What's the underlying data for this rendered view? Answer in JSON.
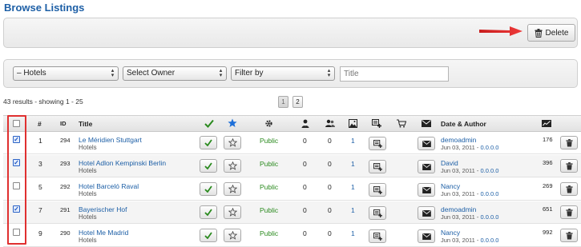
{
  "page": {
    "title": "Browse Listings"
  },
  "toolbar": {
    "delete_label": "Delete"
  },
  "filters": {
    "category": "– Hotels",
    "owner": "Select Owner",
    "filter_by": "Filter by",
    "title_placeholder": "Title"
  },
  "results": {
    "info": "43 results - showing 1 - 25"
  },
  "pagination": [
    "1",
    "2"
  ],
  "columns": {
    "num": "#",
    "id": "ID",
    "title": "Title",
    "date_author": "Date & Author"
  },
  "rows": [
    {
      "checked": true,
      "num": "1",
      "id": "294",
      "title": "Le Méridien Stuttgart",
      "category": "Hotels",
      "status": "Public",
      "c1": "0",
      "c2": "0",
      "images": "1",
      "author": "demoadmin",
      "date": "Jun 03, 2011 -",
      "ip": "0.0.0.0",
      "hits": "176"
    },
    {
      "checked": true,
      "num": "3",
      "id": "293",
      "title": "Hotel Adlon Kempinski Berlin",
      "category": "Hotels",
      "status": "Public",
      "c1": "0",
      "c2": "0",
      "images": "1",
      "author": "David",
      "date": "Jun 03, 2011 -",
      "ip": "0.0.0.0",
      "hits": "396"
    },
    {
      "checked": false,
      "num": "5",
      "id": "292",
      "title": "Hotel Barceló Raval",
      "category": "Hotels",
      "status": "Public",
      "c1": "0",
      "c2": "0",
      "images": "1",
      "author": "Nancy",
      "date": "Jun 03, 2011 -",
      "ip": "0.0.0.0",
      "hits": "269"
    },
    {
      "checked": true,
      "num": "7",
      "id": "291",
      "title": "Bayerischer Hof",
      "category": "Hotels",
      "status": "Public",
      "c1": "0",
      "c2": "0",
      "images": "1",
      "author": "demoadmin",
      "date": "Jun 03, 2011 -",
      "ip": "0.0.0.0",
      "hits": "651"
    },
    {
      "checked": false,
      "num": "9",
      "id": "290",
      "title": "Hotel Me Madrid",
      "category": "Hotels",
      "status": "Public",
      "c1": "0",
      "c2": "0",
      "images": "1",
      "author": "Nancy",
      "date": "Jun 03, 2011 -",
      "ip": "0.0.0.0",
      "hits": "992"
    }
  ],
  "colors": {
    "accent": "#1d5fa6",
    "public": "#2a8a1e",
    "highlight": "#e03030",
    "star": "#1d6fd8",
    "check": "#2a8a1e"
  },
  "icons": {
    "delete": "trash-icon",
    "featured": "star-icon",
    "published": "check-icon",
    "settings": "gear-icon",
    "owner": "person-icon",
    "claims": "people-icon",
    "images": "image-icon",
    "add_review": "add-review-icon",
    "cart": "cart-icon",
    "mail": "envelope-icon",
    "stats": "chart-icon"
  }
}
